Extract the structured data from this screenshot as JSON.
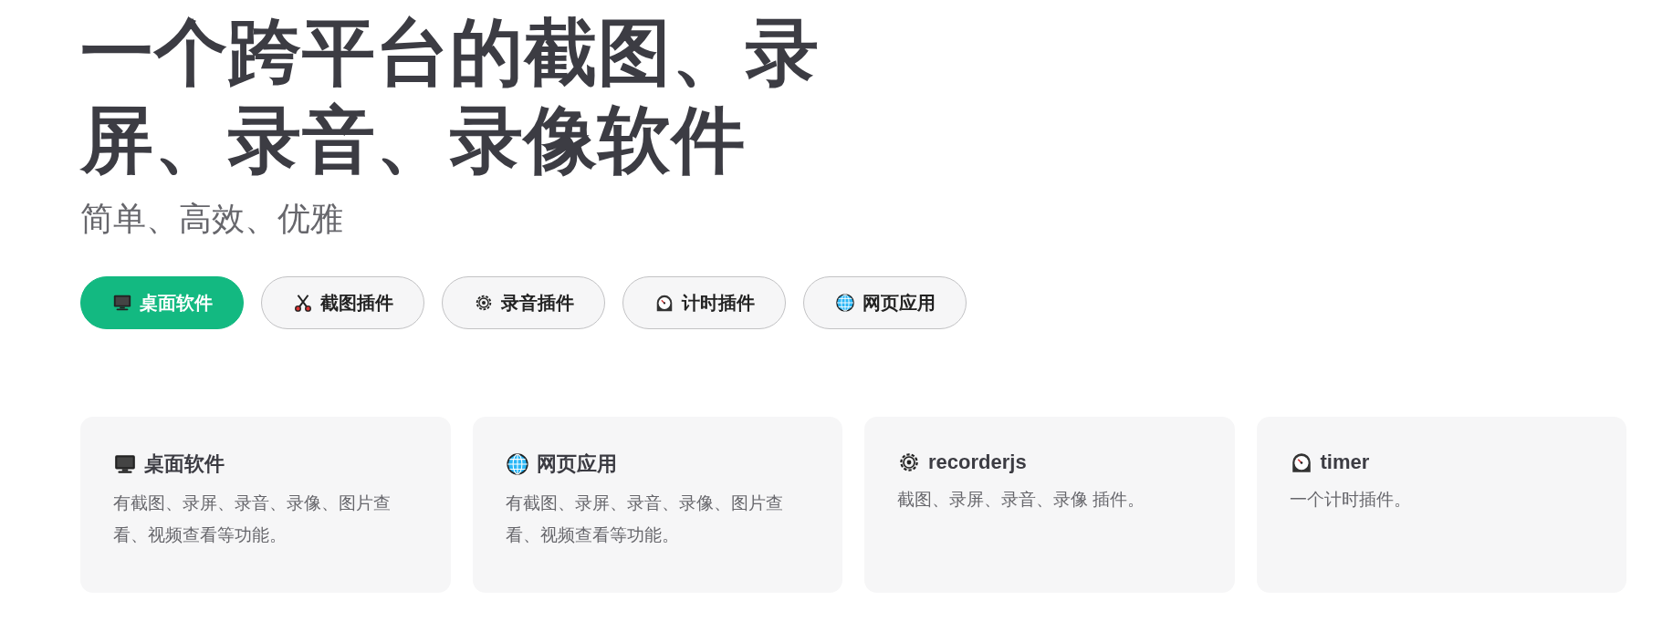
{
  "hero": {
    "title": "一个跨平台的截图、录屏、录音、录像软件",
    "tagline": "简单、高效、优雅",
    "actions": [
      {
        "label": "桌面软件",
        "kind": "brand"
      },
      {
        "label": "截图插件",
        "kind": "alt"
      },
      {
        "label": "录音插件",
        "kind": "alt"
      },
      {
        "label": "计时插件",
        "kind": "alt"
      },
      {
        "label": "网页应用",
        "kind": "alt"
      }
    ]
  },
  "features": [
    {
      "title": "桌面软件",
      "details": "有截图、录屏、录音、录像、图片查看、视频查看等功能。"
    },
    {
      "title": "网页应用",
      "details": "有截图、录屏、录音、录像、图片查看、视频查看等功能。"
    },
    {
      "title": "recorderjs",
      "details": "截图、录屏、录音、录像 插件。"
    },
    {
      "title": "timer",
      "details": "一个计时插件。"
    }
  ]
}
